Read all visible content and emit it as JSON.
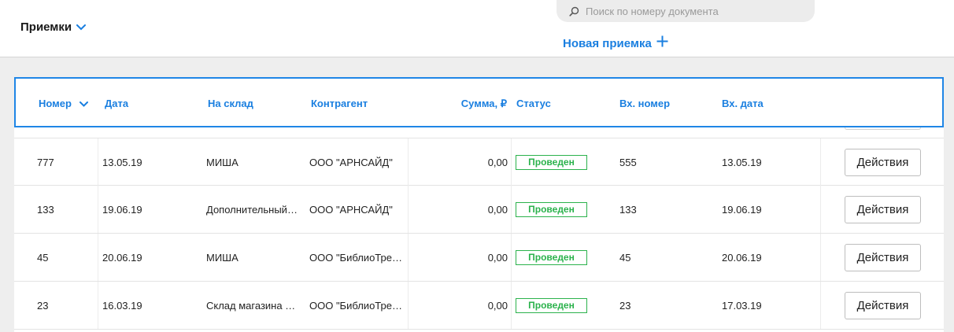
{
  "header": {
    "title": "Приемки",
    "search_placeholder": "Поиск по номеру документа",
    "new_label": "Новая приемка"
  },
  "colors": {
    "accent": "#1a7fe0",
    "status_ok": "#2bb24c",
    "frame": "#1f86e6"
  },
  "icons": {
    "title_dropdown": "chevron-down-icon",
    "search": "search-icon",
    "new": "plus-icon",
    "sort": "chevron-down-icon"
  },
  "table": {
    "columns": {
      "number": "Номер",
      "date": "Дата",
      "warehouse": "На склад",
      "counterparty": "Контрагент",
      "sum": "Сумма, ₽",
      "status": "Статус",
      "in_number": "Вх. номер",
      "in_date": "Вх. дата"
    },
    "rows": [
      {
        "number": "777",
        "date": "13.05.19",
        "warehouse": "МИША",
        "counterparty": "ООО \"АРНСАЙД\"",
        "sum": "0,00",
        "status": "Проведен",
        "in_number": "555",
        "in_date": "13.05.19",
        "action": "Действия"
      },
      {
        "number": "133",
        "date": "19.06.19",
        "warehouse": "Дополнительный…",
        "counterparty": "ООО \"АРНСАЙД\"",
        "sum": "0,00",
        "status": "Проведен",
        "in_number": "133",
        "in_date": "19.06.19",
        "action": "Действия"
      },
      {
        "number": "45",
        "date": "20.06.19",
        "warehouse": "МИША",
        "counterparty": "ООО \"БиблиоТре…",
        "sum": "0,00",
        "status": "Проведен",
        "in_number": "45",
        "in_date": "20.06.19",
        "action": "Действия"
      },
      {
        "number": "23",
        "date": "16.03.19",
        "warehouse": "Склад магазина …",
        "counterparty": "ООО \"БиблиоТре…",
        "sum": "0,00",
        "status": "Проведен",
        "in_number": "23",
        "in_date": "17.03.19",
        "action": "Действия"
      }
    ]
  }
}
